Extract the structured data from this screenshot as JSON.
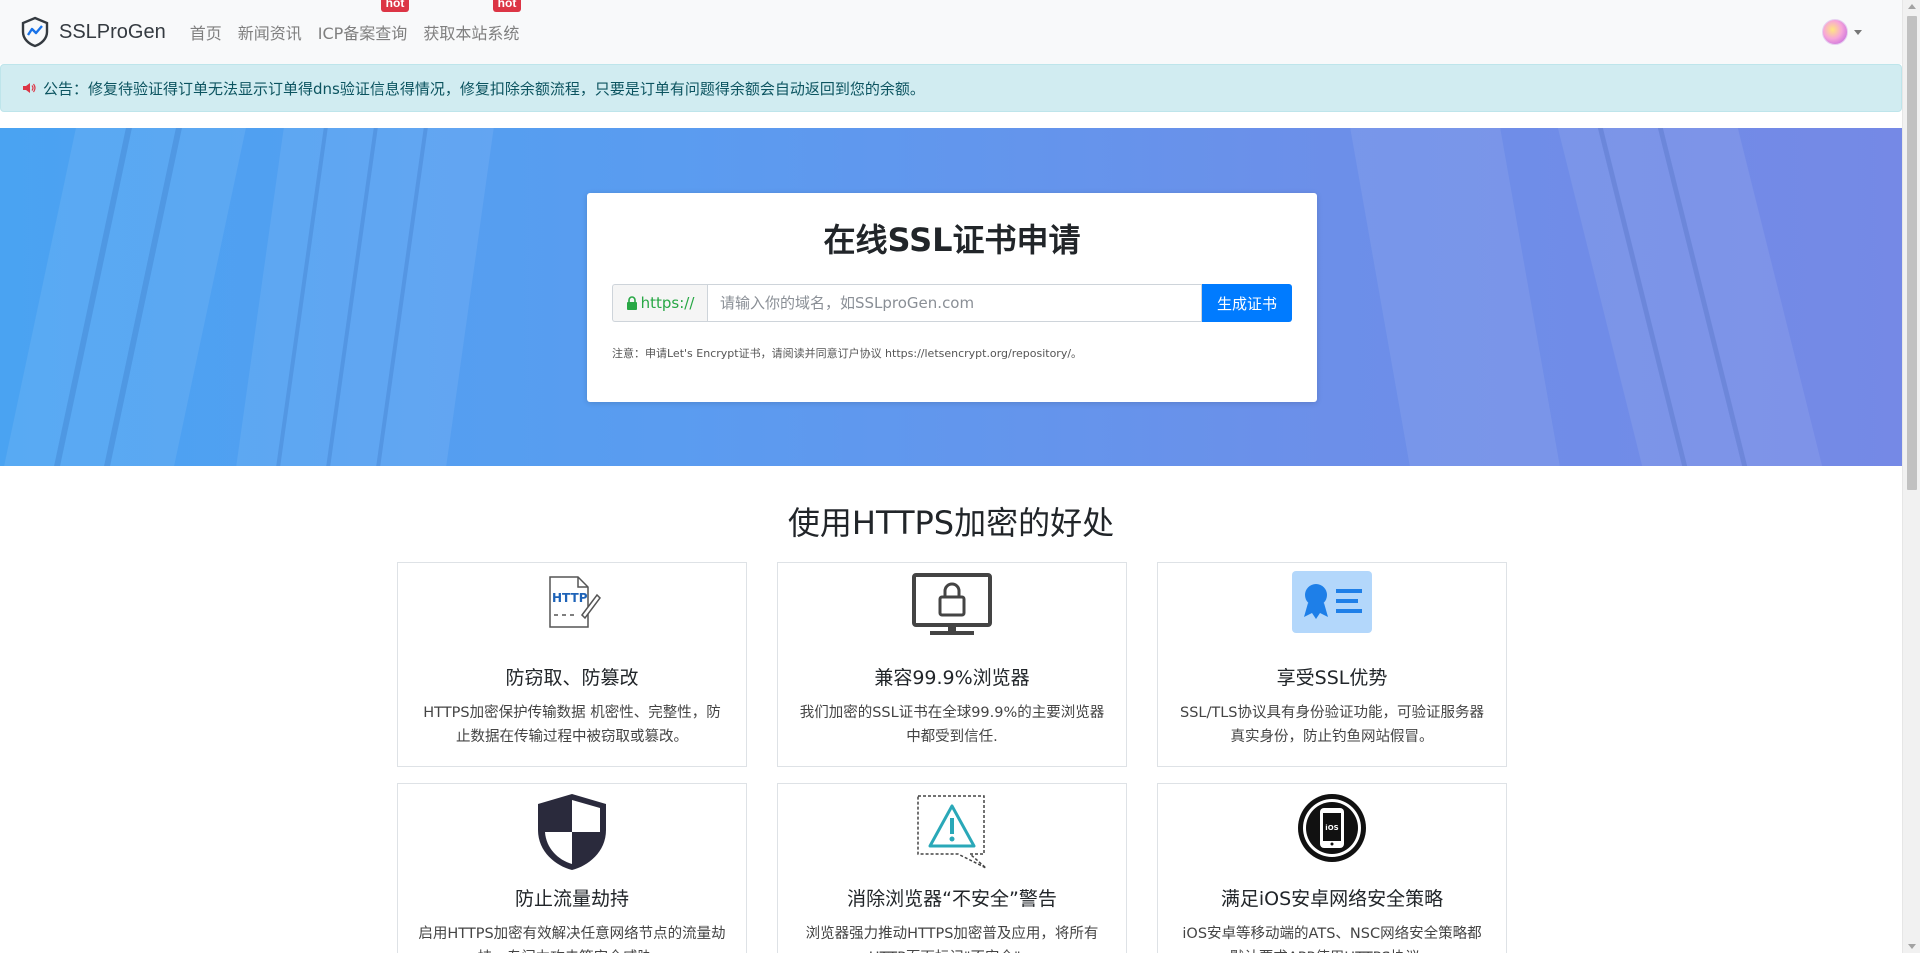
{
  "brand": {
    "name": "SSLProGen"
  },
  "nav": {
    "items": [
      {
        "label": "首页",
        "hot": ""
      },
      {
        "label": "新闻资讯",
        "hot": ""
      },
      {
        "label": "ICP备案查询",
        "hot": "hot"
      },
      {
        "label": "获取本站系统",
        "hot": "hot"
      }
    ]
  },
  "notice": {
    "text": "公告：修复待验证得订单无法显示订单得dns验证信息得情况，修复扣除余额流程，只要是订单有问题得余额会自动返回到您的余额。"
  },
  "hero": {
    "title": "在线SSL证书申请",
    "prefix": "https://",
    "input_placeholder": "请输入你的域名，如SSLproGen.com",
    "button_label": "生成证书",
    "note": "注意：申请Let's Encrypt证书，请阅读并同意订户协议 https://letsencrypt.org/repository/。"
  },
  "section": {
    "title": "使用HTTPS加密的好处",
    "features": [
      {
        "title": "防窃取、防篡改",
        "desc": "HTTPS加密保护传输数据 机密性、完整性，防止数据在传输过程中被窃取或篡改。",
        "icon": "http-document-icon"
      },
      {
        "title": "兼容99.9%浏览器",
        "desc": "我们加密的SSL证书在全球99.9%的主要浏览器中都受到信任.",
        "icon": "monitor-lock-icon"
      },
      {
        "title": "享受SSL优势",
        "desc": "SSL/TLS协议具有身份验证功能，可验证服务器真实身份，防止钓鱼网站假冒。",
        "icon": "certificate-icon"
      },
      {
        "title": "防止流量劫持",
        "desc": "启用HTTPS加密有效解决任意网络节点的流量劫持，专门力攻击等安全威胁。",
        "icon": "shield-icon"
      },
      {
        "title": "消除浏览器“不安全”警告",
        "desc": "浏览器强力推动HTTPS加密普及应用，将所有HTTP页面标记\"不安全\"。",
        "icon": "warning-icon"
      },
      {
        "title": "满足iOS安卓网络安全策略",
        "desc": "iOS安卓等移动端的ATS、NSC网络安全策略都默认要求APP使用HTTPS协议。",
        "icon": "ios-phone-icon"
      }
    ]
  }
}
